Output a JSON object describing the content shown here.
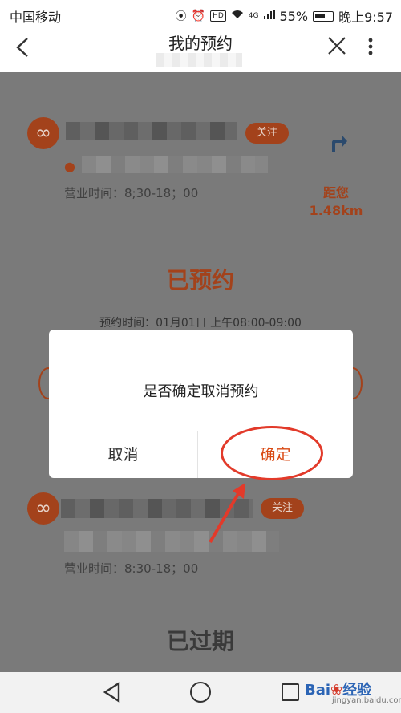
{
  "status_bar": {
    "carrier": "中国移动",
    "network": "4G",
    "hd_badge": "HD",
    "battery": "55%",
    "time": "晚上9:57"
  },
  "header": {
    "title": "我的预约",
    "back_icon": "chevron-left-icon",
    "close_icon": "close-icon",
    "more_icon": "more-vertical-icon"
  },
  "appointments": [
    {
      "follow_label": "关注",
      "hours": "营业时间：8;30-18；00",
      "distance_label": "距您",
      "distance_value": "1.48km",
      "status": "已预约",
      "appointment_time": "预约时间：01月01日 上午08:00-09:00"
    },
    {
      "follow_label": "关注",
      "hours": "营业时间：8:30-18；00",
      "status": "已过期"
    }
  ],
  "dialog": {
    "message": "是否确定取消预约",
    "cancel_label": "取消",
    "confirm_label": "确定"
  },
  "watermark": {
    "text": "Bai",
    "text_suffix": "经验",
    "sub": "jingyan.baidu.com"
  },
  "colors": {
    "accent": "#d94a14",
    "annotation": "#e23a2a",
    "overlay_bg": "#7a7a7a"
  }
}
